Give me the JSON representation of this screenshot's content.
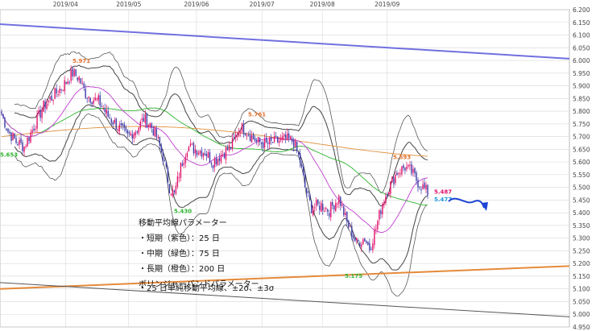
{
  "chart_data": {
    "type": "candlestick",
    "x_ticks": [
      "2019/04",
      "2019/05",
      "2019/06",
      "2019/07",
      "2019/08",
      "2019/09"
    ],
    "y_ticks": [
      "6.200",
      "6.150",
      "6.100",
      "6.050",
      "6.000",
      "5.950",
      "5.900",
      "5.850",
      "5.800",
      "5.750",
      "5.700",
      "5.650",
      "5.600",
      "5.550",
      "5.500",
      "5.450",
      "5.400",
      "5.350",
      "5.300",
      "5.250",
      "5.200",
      "5.150",
      "5.100",
      "5.050",
      "5.000",
      "4.950"
    ],
    "ylim": [
      4.95,
      6.2
    ],
    "grid": true,
    "price_labels": [
      {
        "text": "5.971",
        "value": 5.971,
        "color": "#e0702a"
      },
      {
        "text": "5.761",
        "value": 5.761,
        "color": "#e0702a"
      },
      {
        "text": "5.593",
        "value": 5.593,
        "color": "#e0702a"
      },
      {
        "text": "5.653",
        "value": 5.653,
        "color": "#2fb52f"
      },
      {
        "text": "5.430",
        "value": 5.43,
        "color": "#2fb52f"
      },
      {
        "text": "5.175",
        "value": 5.175,
        "color": "#2fb52f"
      },
      {
        "text": "5.487",
        "value": 5.487,
        "color": "#e0106a"
      },
      {
        "text": "5.477",
        "value": 5.477,
        "color": "#1a9ae0"
      }
    ],
    "trendlines": [
      {
        "color": "#7070e0",
        "from": [
          0,
          6.143
        ],
        "to": [
          1,
          6.007
        ]
      },
      {
        "color": "#e58a3a",
        "from": [
          0,
          5.1
        ],
        "to": [
          1,
          5.19
        ]
      },
      {
        "color": "#555555",
        "from": [
          0,
          5.125
        ],
        "to": [
          1,
          4.99
        ]
      }
    ],
    "colors": {
      "up": "#e0106a",
      "down": "#3b3aa8",
      "ma_short": "#c040d0",
      "ma_mid": "#2fb52f",
      "ma_long": "#e0903a",
      "bands": "#444444",
      "grid": "#d8d8d8"
    }
  },
  "annotation": {
    "title_ma": "移動平均線パラメーター",
    "ma_short": "・短期（紫色）：25 日",
    "ma_mid": "・中期（緑色）：75 日",
    "ma_long": "・長期（橙色）：200 日",
    "title_bb": "ボリンジャーバンドパラメーター",
    "bb_param": "・25 日単純移動平均線、±2σ、±3σ"
  }
}
